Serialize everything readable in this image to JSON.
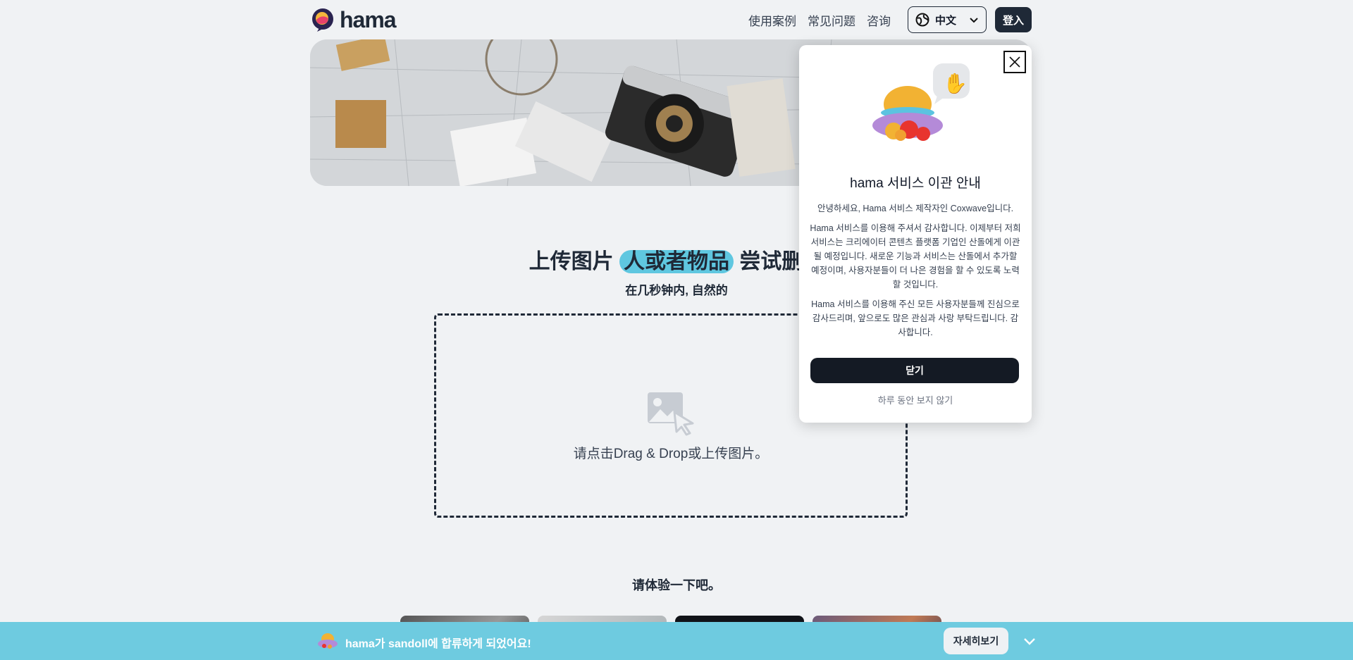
{
  "header": {
    "logo_text": "hama",
    "nav": [
      "使用案例",
      "常见问题",
      "咨询"
    ],
    "language": "中文",
    "login_label": "登入"
  },
  "main": {
    "headline_pre": "上传图片 ",
    "headline_highlight": "人或者物品",
    "headline_post": " 尝试删除",
    "subline": "在几秒钟内, 自然的",
    "dropzone_text": "请点击Drag & Drop或上传图片。",
    "try_title": "请体验一下吧。"
  },
  "modal": {
    "title": "hama 서비스 이관 안내",
    "paragraphs": [
      "안녕하세요, Hama 서비스 제작자인 Coxwave입니다.",
      "Hama 서비스를 이용해 주셔서 감사합니다. 이제부터 저희 서비스는 크리에이터 콘텐츠 플랫폼 기업인 산돌에게 이관될 예정입니다. 새로운 기능과 서비스는 산돌에서 추가할 예정이며, 사용자분들이 더 나은 경험을 할 수 있도록 노력할 것입니다.",
      "Hama 서비스를 이용해 주신 모든 사용자분들께 진심으로 감사드리며, 앞으로도 많은 관심과 사랑 부탁드립니다. 감사합니다."
    ],
    "close_label": "닫기",
    "skip_label": "하루 동안 보지 않기"
  },
  "bottom_bar": {
    "text": "hama가 sandoll에 합류하게 되었어요!",
    "button_label": "자세히보기"
  },
  "colors": {
    "accent": "#5fc7e0",
    "bar": "#6ecbe0",
    "dark": "#1f2937"
  }
}
